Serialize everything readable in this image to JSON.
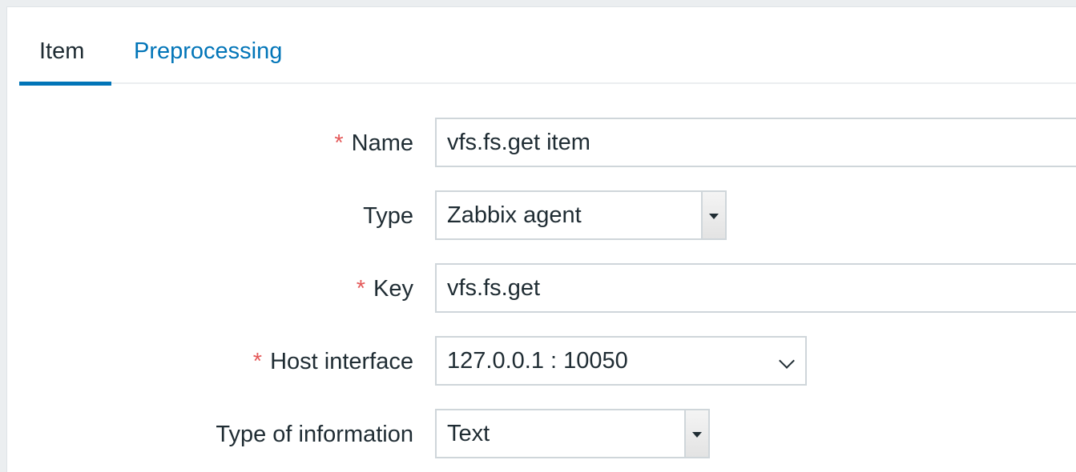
{
  "tabs": {
    "item": "Item",
    "preprocessing": "Preprocessing"
  },
  "form": {
    "required_mark": "*",
    "name": {
      "label": "Name",
      "value": "vfs.fs.get item",
      "required": true
    },
    "type": {
      "label": "Type",
      "value": "Zabbix agent"
    },
    "key": {
      "label": "Key",
      "value": "vfs.fs.get",
      "required": true
    },
    "host_interface": {
      "label": "Host interface",
      "value": "127.0.0.1 : 10050",
      "required": true
    },
    "type_of_information": {
      "label": "Type of information",
      "value": "Text"
    }
  },
  "colors": {
    "accent": "#0275b8",
    "required": "#e45959",
    "text": "#1f2c33",
    "border": "#cfd6da",
    "background": "#ebeef0"
  }
}
